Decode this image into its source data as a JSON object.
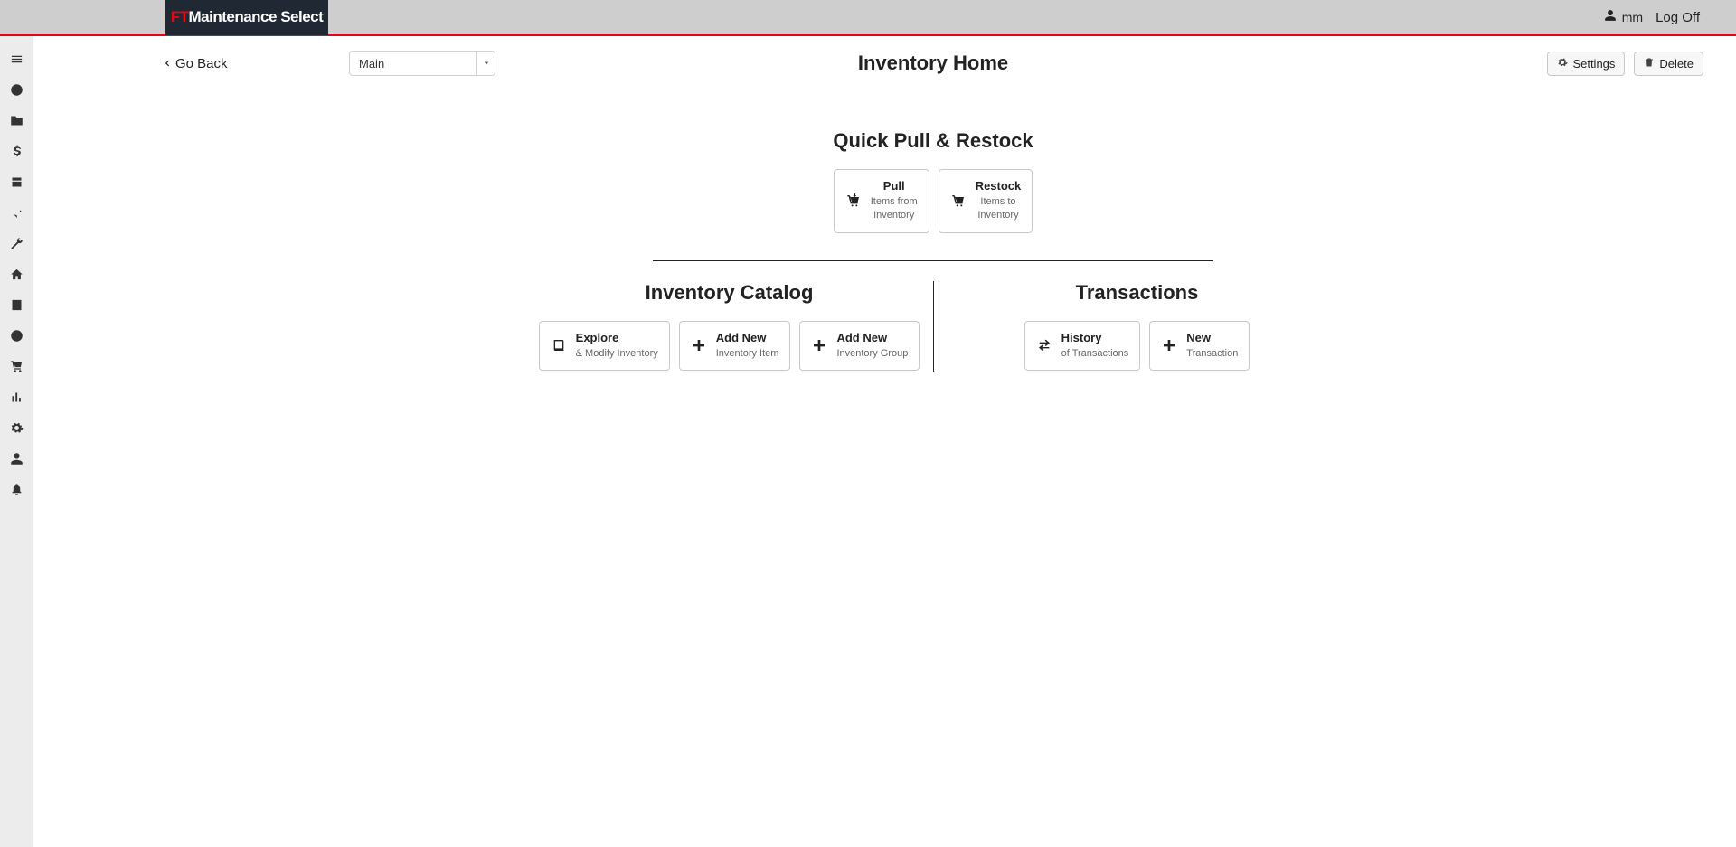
{
  "brand": {
    "ft": "FT",
    "rest": "Maintenance Select"
  },
  "header": {
    "username": "mm",
    "logoff": "Log Off"
  },
  "toolbar": {
    "go_back": "Go Back",
    "dropdown_value": "Main",
    "page_title": "Inventory Home",
    "settings": "Settings",
    "delete": "Delete"
  },
  "quick": {
    "title": "Quick Pull & Restock",
    "pull": {
      "title": "Pull",
      "line1": "Items from",
      "line2": "Inventory"
    },
    "restock": {
      "title": "Restock",
      "line1": "Items to",
      "line2": "Inventory"
    }
  },
  "catalog": {
    "title": "Inventory Catalog",
    "explore": {
      "title": "Explore",
      "sub": "& Modify Inventory"
    },
    "add_item": {
      "title": "Add New",
      "sub": "Inventory Item"
    },
    "add_group": {
      "title": "Add New",
      "sub": "Inventory Group"
    }
  },
  "transactions": {
    "title": "Transactions",
    "history": {
      "title": "History",
      "sub": "of Transactions"
    },
    "new": {
      "title": "New",
      "sub": "Transaction"
    }
  }
}
